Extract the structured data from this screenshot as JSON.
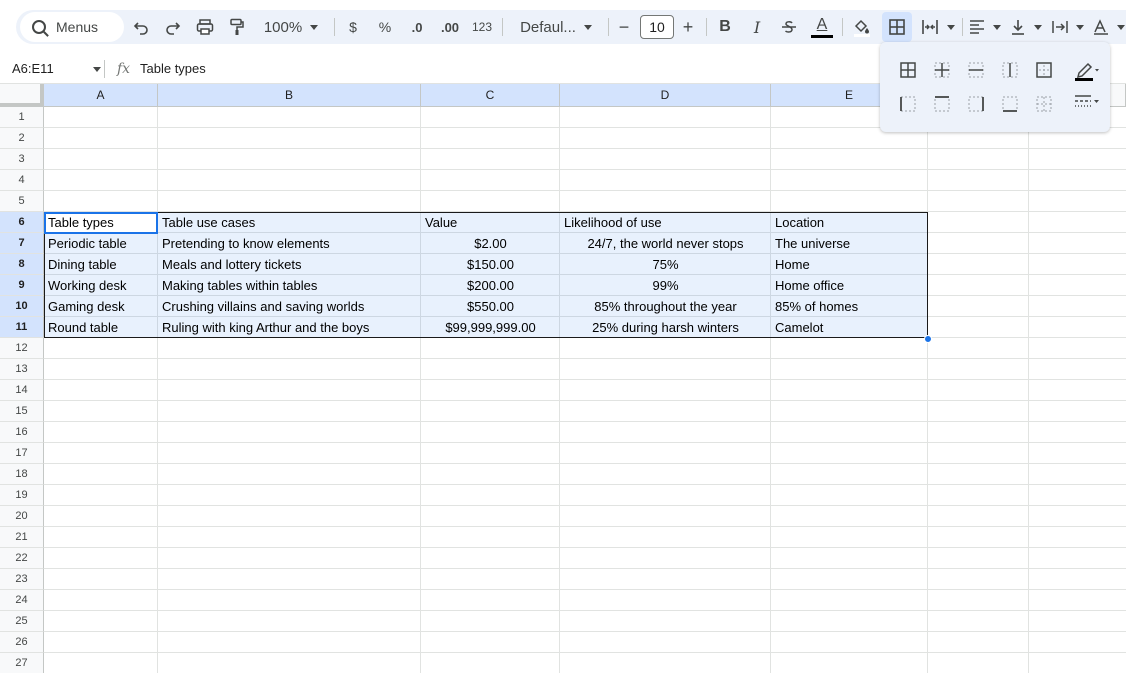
{
  "toolbar": {
    "menus_label": "Menus",
    "zoom": "100%",
    "currency": "$",
    "percent": "%",
    "decrease_decimal": ".0",
    "increase_decimal": ".00",
    "number_format": "123",
    "font_name": "Defaul...",
    "font_size": "10",
    "minus": "−",
    "plus": "+",
    "bold": "B",
    "italic": "I",
    "text_color_letter": "A",
    "accent_color": "#1a73e8"
  },
  "formula_bar": {
    "name_box": "A6:E11",
    "fx": "fx",
    "formula": "Table types"
  },
  "columns": [
    "A",
    "B",
    "C",
    "D",
    "E"
  ],
  "rows": [
    "1",
    "2",
    "3",
    "4",
    "5",
    "6",
    "7",
    "8",
    "9",
    "10",
    "11",
    "12",
    "13",
    "14",
    "15",
    "16",
    "17",
    "18",
    "19",
    "20",
    "21",
    "22",
    "23",
    "24",
    "25",
    "26",
    "27"
  ],
  "table": {
    "header": [
      "Table types",
      "Table use cases",
      "Value",
      "Likelihood of use",
      "Location"
    ],
    "rows": [
      [
        "Periodic table",
        "Pretending to know elements",
        "$2.00",
        "24/7, the world never stops",
        "The universe"
      ],
      [
        "Dining table",
        "Meals and lottery tickets",
        "$150.00",
        "75%",
        "Home"
      ],
      [
        "Working desk",
        "Making tables within tables",
        "$200.00",
        "99%",
        "Home office"
      ],
      [
        "Gaming desk",
        "Crushing villains and saving worlds",
        "$550.00",
        "85% throughout the year",
        "85% of homes"
      ],
      [
        "Round table",
        "Ruling with king Arthur and the boys",
        "$99,999,999.00",
        "25% during harsh winters",
        "Camelot"
      ]
    ]
  }
}
